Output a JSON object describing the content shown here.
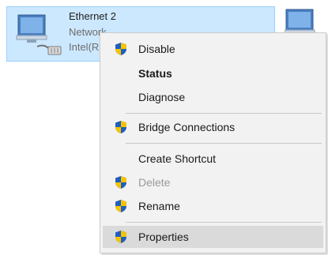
{
  "adapter": {
    "name": "Ethernet 2",
    "status": "Network",
    "device": "Intel(R"
  },
  "context_menu": {
    "items": [
      {
        "label": "Disable",
        "shield": true,
        "bold": false,
        "disabled": false
      },
      {
        "label": "Status",
        "shield": false,
        "bold": true,
        "disabled": false
      },
      {
        "label": "Diagnose",
        "shield": false,
        "bold": false,
        "disabled": false
      },
      {
        "label": "Bridge Connections",
        "shield": true,
        "bold": false,
        "disabled": false
      },
      {
        "label": "Create Shortcut",
        "shield": false,
        "bold": false,
        "disabled": false
      },
      {
        "label": "Delete",
        "shield": true,
        "bold": false,
        "disabled": true
      },
      {
        "label": "Rename",
        "shield": true,
        "bold": false,
        "disabled": false
      },
      {
        "label": "Properties",
        "shield": true,
        "bold": false,
        "disabled": false,
        "highlighted": true
      }
    ]
  },
  "colors": {
    "selection_fill": "#cce8ff",
    "selection_border": "#99d1ff",
    "menu_background": "#f2f2f2",
    "menu_highlight": "#dadada",
    "disabled_text": "#9a9a9a",
    "shield_blue": "#1f5fbf",
    "shield_yellow": "#f5c400"
  }
}
